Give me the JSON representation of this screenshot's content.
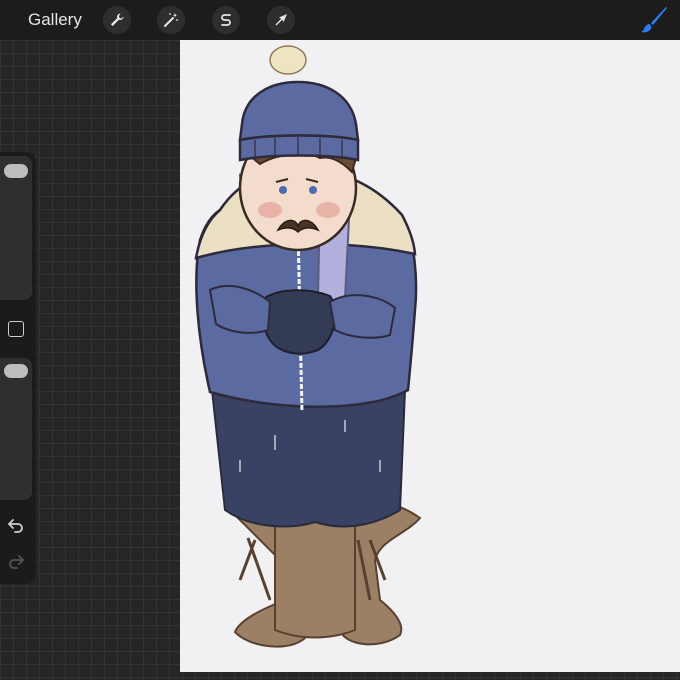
{
  "toolbar": {
    "gallery_label": "Gallery",
    "tools": [
      {
        "name": "actions",
        "icon": "wrench-icon"
      },
      {
        "name": "adjustments",
        "icon": "magic-wand-icon"
      },
      {
        "name": "selection",
        "icon": "selection-s-icon"
      },
      {
        "name": "transform",
        "icon": "arrow-cursor-icon"
      }
    ],
    "active_tool_icon": "brush-icon",
    "accent_color": "#2b7cf6"
  },
  "sidebar": {
    "brush_size_icon": "size-slider",
    "opacity_icon": "opacity-slider",
    "modify_icon": "square-icon",
    "undo_icon": "undo-icon",
    "redo_icon": "redo-icon"
  },
  "canvas": {
    "background_color": "#f1f1f3",
    "subject": "illustration"
  }
}
